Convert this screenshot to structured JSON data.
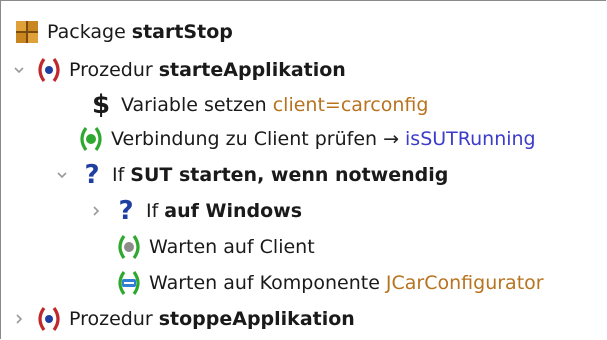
{
  "tree": {
    "package": {
      "label": "Package",
      "name": "startStop"
    },
    "proc1": {
      "label": "Prozedur",
      "name": "starteApplikation"
    },
    "var": {
      "label": "Variable setzen",
      "value": "client=carconfig"
    },
    "connect": {
      "label": "Verbindung zu Client prüfen",
      "arrow": "→",
      "target": "isSUTRunning"
    },
    "if1": {
      "label": "If",
      "condition": "SUT starten, wenn notwendig"
    },
    "if2": {
      "label": "If",
      "condition": "auf Windows"
    },
    "wait_client": {
      "label": "Warten auf Client"
    },
    "wait_comp": {
      "label": "Warten auf Komponente",
      "value": "JCarConfigurator"
    },
    "proc2": {
      "label": "Prozedur",
      "name": "stoppeApplikation"
    }
  },
  "colors": {
    "procedure_red": "#c0282a",
    "procedure_blue": "#1f3fa0",
    "green": "#2fa82f",
    "value_orange": "#b8731f",
    "link_blue": "#3c3cc8"
  }
}
